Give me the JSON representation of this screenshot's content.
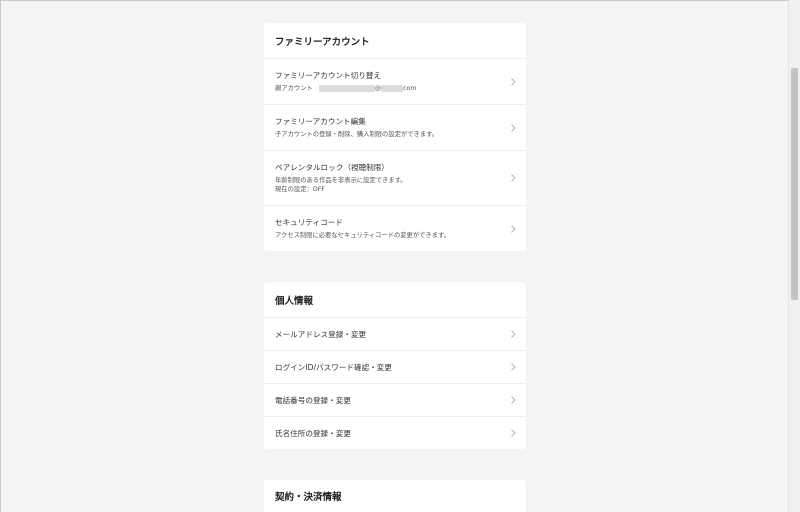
{
  "family_section": {
    "title": "ファミリーアカウント",
    "items": [
      {
        "label": "ファミリーアカウント切り替え",
        "desc_prefix": "親アカウント",
        "desc_at": "@",
        "desc_suffix": "com"
      },
      {
        "label": "ファミリーアカウント編集",
        "desc": "子アカウントの登録・削除、購入制限の設定ができます。"
      },
      {
        "label": "ペアレンタルロック（視聴制限）",
        "desc": "年齢制限のある作品を非表示に設定できます。",
        "desc2": "現在の設定：OFF"
      },
      {
        "label": "セキュリティコード",
        "desc": "アクセス制限に必要なセキュリティコードの変更ができます。"
      }
    ]
  },
  "personal_section": {
    "title": "個人情報",
    "items": [
      {
        "label": "メールアドレス登録・変更"
      },
      {
        "label": "ログインID/パスワード確認・変更"
      },
      {
        "label": "電話番号の登録・変更"
      },
      {
        "label": "氏名住所の登録・変更"
      }
    ]
  },
  "contract_section": {
    "title": "契約・決済情報"
  },
  "icons": {
    "row_chevron": "chevron-right-icon"
  },
  "colors": {
    "background": "#f4f4f5",
    "card": "#ffffff",
    "divider": "#ececec",
    "chevron": "#b5b5b5"
  }
}
